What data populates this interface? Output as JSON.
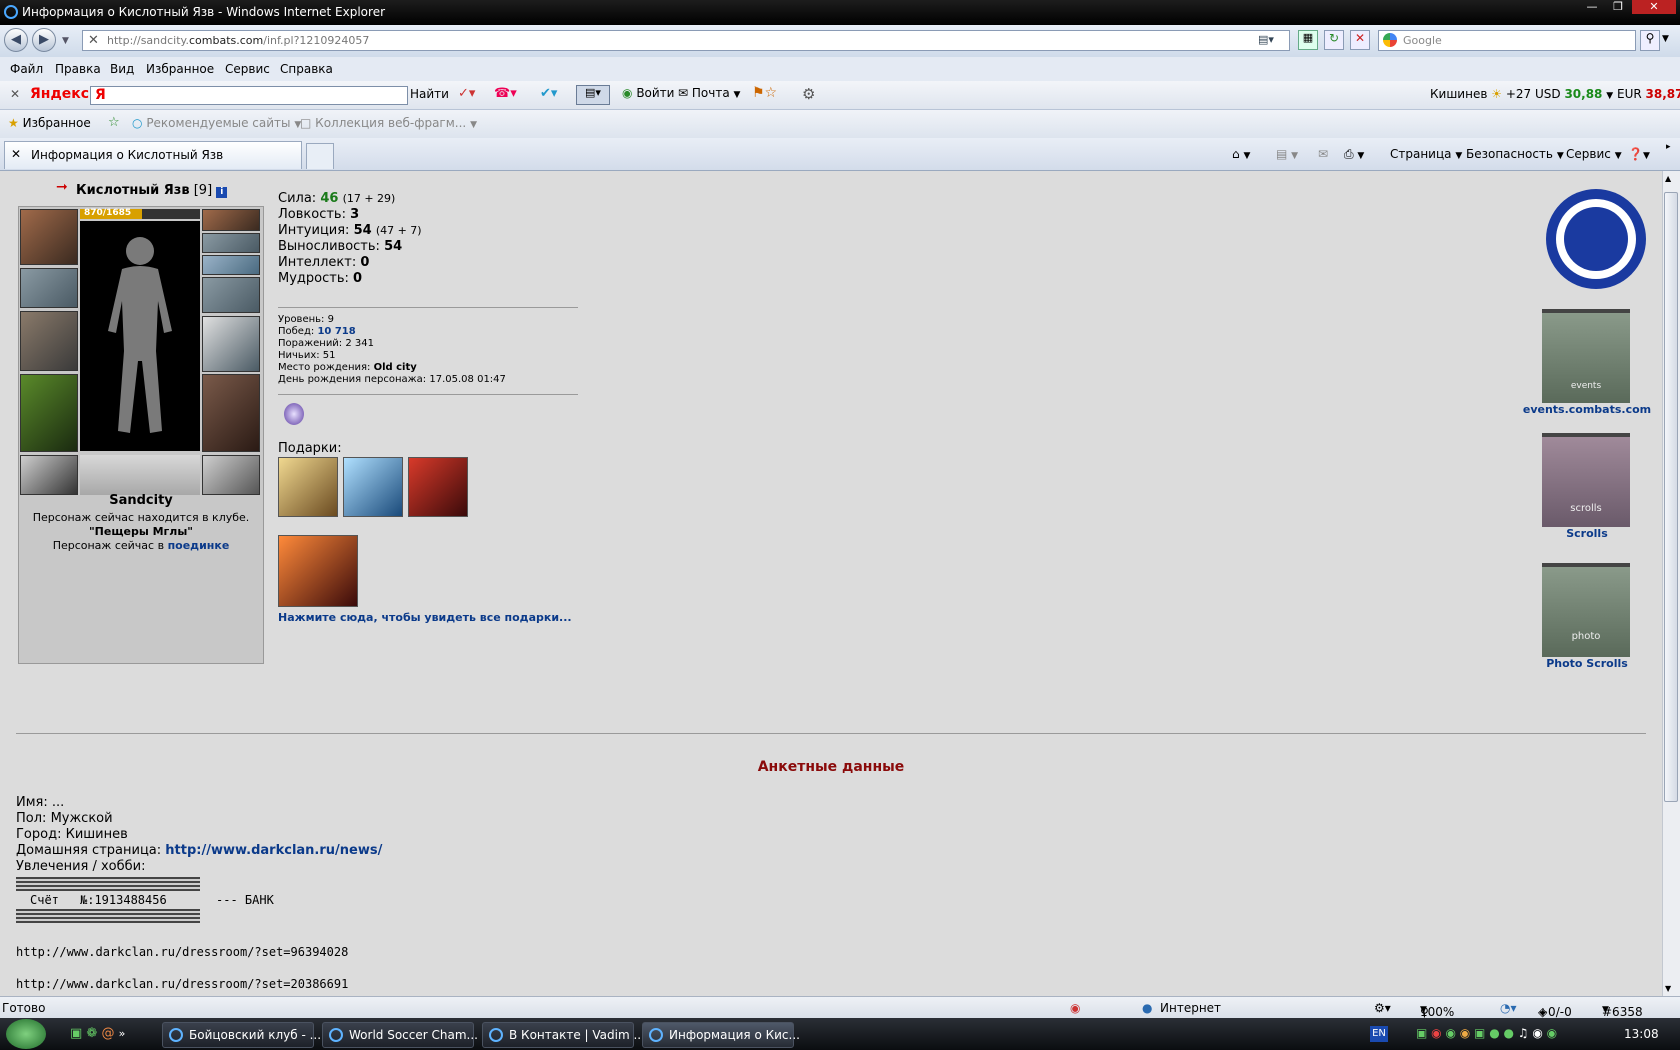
{
  "window": {
    "title": "Информация о Кислотный Язв - Windows Internet Explorer",
    "url_prefix": "http://sandcity.",
    "url_domain": "combats.com",
    "url_path": "/inf.pl?1210924057",
    "search_placeholder": "Google"
  },
  "menu": [
    "Файл",
    "Правка",
    "Вид",
    "Избранное",
    "Сервис",
    "Справка"
  ],
  "yandexbar": {
    "brand": "Яндекс",
    "input_value": "Я",
    "find": "Найти",
    "login": "Войти",
    "mail": "Почта",
    "city": "Кишинев",
    "temp": "+27",
    "usd_label": "USD",
    "usd_value": "30,88",
    "eur_label": "EUR",
    "eur_value": "38,87"
  },
  "favbar": {
    "favorites": "Избранное",
    "recommended": "Рекомендуемые сайты",
    "webslices": "Коллекция веб-фрагм..."
  },
  "tab": {
    "label": "Информация о Кислотный Язв"
  },
  "commandbar": {
    "page": "Страница",
    "security": "Безопасность",
    "service": "Сервис"
  },
  "character": {
    "name": "Кислотный Язв",
    "level_tag": "[9]",
    "hp": "870/1685",
    "clan": "Sandcity",
    "location_line": "Персонаж сейчас находится в клубе.",
    "location_name": "\"Пещеры Мглы\"",
    "battle_prefix": "Персонаж сейчас в",
    "battle_link": "поединке"
  },
  "stats": [
    {
      "label": "Сила:",
      "value": "46",
      "extra": "(17 + 29)",
      "color": "#1a7a1a"
    },
    {
      "label": "Ловкость:",
      "value": "3",
      "extra": "",
      "color": "#000000"
    },
    {
      "label": "Интуиция:",
      "value": "54",
      "extra": "(47 + 7)",
      "color": "#000000"
    },
    {
      "label": "Выносливость:",
      "value": "54",
      "extra": "",
      "color": "#000000"
    },
    {
      "label": "Интеллект:",
      "value": "0",
      "extra": "",
      "color": "#000000"
    },
    {
      "label": "Мудрость:",
      "value": "0",
      "extra": "",
      "color": "#000000"
    }
  ],
  "info": {
    "level_label": "Уровень:",
    "level": "9",
    "wins_label": "Побед:",
    "wins": "10 718",
    "losses_label": "Поражений:",
    "losses": "2 341",
    "draws_label": "Ничьих:",
    "draws": "51",
    "birthplace_label": "Место рождения:",
    "birthplace": "Old city",
    "birthday_label": "День рождения персонажа:",
    "birthday": "17.05.08 01:47"
  },
  "gifts": {
    "title": "Подарки:",
    "all_link": "Нажмите сюда, чтобы увидеть все подарки..."
  },
  "side": {
    "events": "events.combats.com",
    "events_banner_text": "events",
    "scrolls": "Scrolls",
    "scrolls_banner_text": "scrolls",
    "photo": "Photo Scrolls",
    "photo_banner_text": "photo"
  },
  "profile": {
    "title": "Анкетные данные",
    "name_label": "Имя:",
    "name": "...",
    "sex_label": "Пол:",
    "sex": "Мужской",
    "city_label": "Город:",
    "city": "Кишинев",
    "homepage_label": "Домашняя страница:",
    "homepage": "http://www.darkclan.ru/news/",
    "hobby_label": "Увлечения / хобби:",
    "account": "Счёт",
    "account_no": "№:1913488456",
    "bank": "--- БАНК",
    "link1": "http://www.darkclan.ru/dressroom/?set=96394028",
    "link2": "http://www.darkclan.ru/dressroom/?set=20386691"
  },
  "statusbar": {
    "ready": "Готово",
    "zone": "Интернет",
    "zoom": "100%",
    "counter": "+0/-0",
    "id": "#6358"
  },
  "taskbar": {
    "tasks": [
      "Бойцовский клуб - ...",
      "World Soccer Cham...",
      "В Контакте | Vadim ...",
      "Информация о Кис..."
    ],
    "lang": "EN",
    "clock": "13:08"
  }
}
